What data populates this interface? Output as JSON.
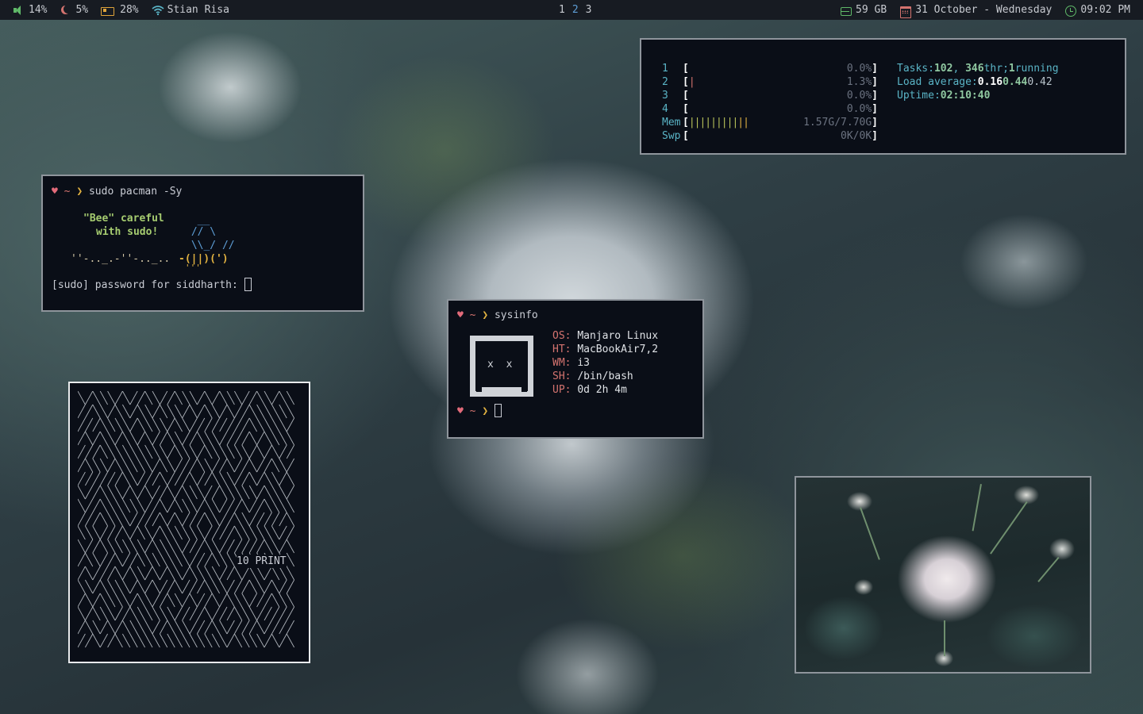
{
  "topbar": {
    "left": [
      {
        "icon": "speaker-icon",
        "text": "14%"
      },
      {
        "icon": "moon-icon",
        "text": "5%"
      },
      {
        "icon": "battery-icon",
        "text": "28%"
      },
      {
        "icon": "wifi-icon",
        "text": "Stian Risa"
      }
    ],
    "workspaces": [
      "1",
      "2",
      "3"
    ],
    "active_workspace": "2",
    "right": [
      {
        "icon": "drive-icon",
        "text": "59 GB"
      },
      {
        "icon": "calendar-icon",
        "text": "31 October - Wednesday"
      },
      {
        "icon": "clock-icon",
        "text": "09:02 PM"
      }
    ]
  },
  "htop": {
    "cpus": [
      {
        "num": "1",
        "bar": "",
        "pct": "0.0%"
      },
      {
        "num": "2",
        "bar": "|",
        "pct": "1.3%"
      },
      {
        "num": "3",
        "bar": "",
        "pct": "0.0%"
      },
      {
        "num": "4",
        "bar": "",
        "pct": "0.0%"
      }
    ],
    "mem": {
      "label": "Mem",
      "bar": "|||||||||",
      "bar_tail": "||",
      "value": "1.57G/7.70G"
    },
    "swp": {
      "label": "Swp",
      "value": "0K/0K"
    },
    "tasks_label": "Tasks:",
    "tasks": "102",
    "threads": "346",
    "thr_label": "thr;",
    "running": "1",
    "running_label": "running",
    "load_label": "Load average:",
    "load1": "0.16",
    "load5": "0.44",
    "load15": "0.42",
    "uptime_label": "Uptime:",
    "uptime": "02:10:40"
  },
  "sudo_term": {
    "prompt_heart": "♥",
    "prompt_tilde": "~",
    "prompt_arrow": "❯",
    "command": "sudo pacman -Sy",
    "bee_line1": "\"Bee\" careful",
    "bee_line2": "with sudo!",
    "bee_art1": "  __",
    "bee_art2": " // \\",
    "bee_art3": " \\\\_/ //",
    "bee_trail": "''-.._.-''-.._.. ",
    "bee_body": "-(||)(')",
    "bee_legs": "'''",
    "password_prompt": "[sudo] password for siddharth:"
  },
  "sysinfo_term": {
    "command": "sysinfo",
    "logo_eyes": "x x",
    "rows": [
      {
        "key": "OS:",
        "value": "Manjaro Linux"
      },
      {
        "key": "HT:",
        "value": "MacBookAir7,2"
      },
      {
        "key": "WM:",
        "value": "i3"
      },
      {
        "key": "SH:",
        "value": "/bin/bash"
      },
      {
        "key": "UP:",
        "value": "0d 2h 4m"
      }
    ]
  },
  "print_window": {
    "label": "10 PRINT"
  },
  "colors": {
    "bar_bg": "#171b22",
    "terminal_bg": "#0a0e17",
    "green": "#5fb868",
    "red": "#d4736f",
    "yellow": "#e3b341",
    "blue": "#5e9ed6",
    "cyan": "#5ab4c6"
  }
}
